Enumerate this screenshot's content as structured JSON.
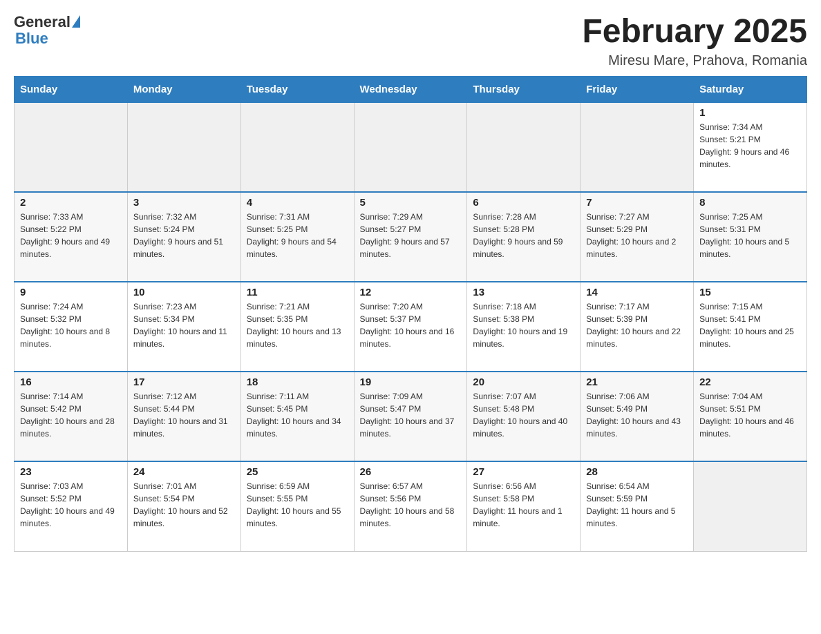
{
  "logo": {
    "general": "General",
    "blue": "Blue"
  },
  "title": "February 2025",
  "subtitle": "Miresu Mare, Prahova, Romania",
  "days_of_week": [
    "Sunday",
    "Monday",
    "Tuesday",
    "Wednesday",
    "Thursday",
    "Friday",
    "Saturday"
  ],
  "weeks": [
    [
      {
        "day": "",
        "info": ""
      },
      {
        "day": "",
        "info": ""
      },
      {
        "day": "",
        "info": ""
      },
      {
        "day": "",
        "info": ""
      },
      {
        "day": "",
        "info": ""
      },
      {
        "day": "",
        "info": ""
      },
      {
        "day": "1",
        "info": "Sunrise: 7:34 AM\nSunset: 5:21 PM\nDaylight: 9 hours and 46 minutes."
      }
    ],
    [
      {
        "day": "2",
        "info": "Sunrise: 7:33 AM\nSunset: 5:22 PM\nDaylight: 9 hours and 49 minutes."
      },
      {
        "day": "3",
        "info": "Sunrise: 7:32 AM\nSunset: 5:24 PM\nDaylight: 9 hours and 51 minutes."
      },
      {
        "day": "4",
        "info": "Sunrise: 7:31 AM\nSunset: 5:25 PM\nDaylight: 9 hours and 54 minutes."
      },
      {
        "day": "5",
        "info": "Sunrise: 7:29 AM\nSunset: 5:27 PM\nDaylight: 9 hours and 57 minutes."
      },
      {
        "day": "6",
        "info": "Sunrise: 7:28 AM\nSunset: 5:28 PM\nDaylight: 9 hours and 59 minutes."
      },
      {
        "day": "7",
        "info": "Sunrise: 7:27 AM\nSunset: 5:29 PM\nDaylight: 10 hours and 2 minutes."
      },
      {
        "day": "8",
        "info": "Sunrise: 7:25 AM\nSunset: 5:31 PM\nDaylight: 10 hours and 5 minutes."
      }
    ],
    [
      {
        "day": "9",
        "info": "Sunrise: 7:24 AM\nSunset: 5:32 PM\nDaylight: 10 hours and 8 minutes."
      },
      {
        "day": "10",
        "info": "Sunrise: 7:23 AM\nSunset: 5:34 PM\nDaylight: 10 hours and 11 minutes."
      },
      {
        "day": "11",
        "info": "Sunrise: 7:21 AM\nSunset: 5:35 PM\nDaylight: 10 hours and 13 minutes."
      },
      {
        "day": "12",
        "info": "Sunrise: 7:20 AM\nSunset: 5:37 PM\nDaylight: 10 hours and 16 minutes."
      },
      {
        "day": "13",
        "info": "Sunrise: 7:18 AM\nSunset: 5:38 PM\nDaylight: 10 hours and 19 minutes."
      },
      {
        "day": "14",
        "info": "Sunrise: 7:17 AM\nSunset: 5:39 PM\nDaylight: 10 hours and 22 minutes."
      },
      {
        "day": "15",
        "info": "Sunrise: 7:15 AM\nSunset: 5:41 PM\nDaylight: 10 hours and 25 minutes."
      }
    ],
    [
      {
        "day": "16",
        "info": "Sunrise: 7:14 AM\nSunset: 5:42 PM\nDaylight: 10 hours and 28 minutes."
      },
      {
        "day": "17",
        "info": "Sunrise: 7:12 AM\nSunset: 5:44 PM\nDaylight: 10 hours and 31 minutes."
      },
      {
        "day": "18",
        "info": "Sunrise: 7:11 AM\nSunset: 5:45 PM\nDaylight: 10 hours and 34 minutes."
      },
      {
        "day": "19",
        "info": "Sunrise: 7:09 AM\nSunset: 5:47 PM\nDaylight: 10 hours and 37 minutes."
      },
      {
        "day": "20",
        "info": "Sunrise: 7:07 AM\nSunset: 5:48 PM\nDaylight: 10 hours and 40 minutes."
      },
      {
        "day": "21",
        "info": "Sunrise: 7:06 AM\nSunset: 5:49 PM\nDaylight: 10 hours and 43 minutes."
      },
      {
        "day": "22",
        "info": "Sunrise: 7:04 AM\nSunset: 5:51 PM\nDaylight: 10 hours and 46 minutes."
      }
    ],
    [
      {
        "day": "23",
        "info": "Sunrise: 7:03 AM\nSunset: 5:52 PM\nDaylight: 10 hours and 49 minutes."
      },
      {
        "day": "24",
        "info": "Sunrise: 7:01 AM\nSunset: 5:54 PM\nDaylight: 10 hours and 52 minutes."
      },
      {
        "day": "25",
        "info": "Sunrise: 6:59 AM\nSunset: 5:55 PM\nDaylight: 10 hours and 55 minutes."
      },
      {
        "day": "26",
        "info": "Sunrise: 6:57 AM\nSunset: 5:56 PM\nDaylight: 10 hours and 58 minutes."
      },
      {
        "day": "27",
        "info": "Sunrise: 6:56 AM\nSunset: 5:58 PM\nDaylight: 11 hours and 1 minute."
      },
      {
        "day": "28",
        "info": "Sunrise: 6:54 AM\nSunset: 5:59 PM\nDaylight: 11 hours and 5 minutes."
      },
      {
        "day": "",
        "info": ""
      }
    ]
  ]
}
